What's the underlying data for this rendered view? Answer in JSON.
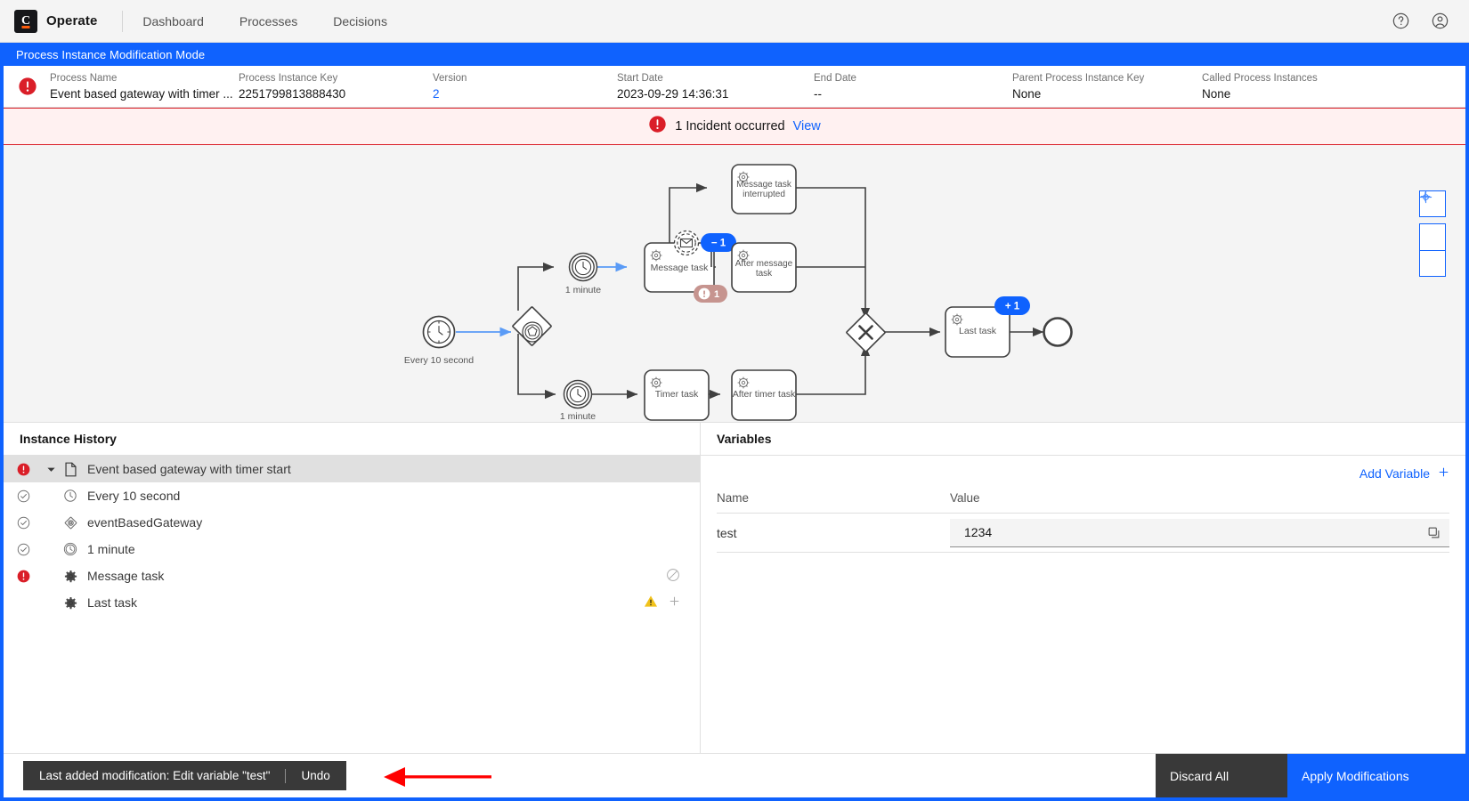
{
  "app": {
    "brand_letter": "C",
    "brand_name": "Operate",
    "nav": [
      {
        "label": "Dashboard",
        "name": "nav-dashboard"
      },
      {
        "label": "Processes",
        "name": "nav-processes"
      },
      {
        "label": "Decisions",
        "name": "nav-decisions"
      }
    ],
    "help_icon": "help-icon",
    "user_icon": "user-avatar-icon"
  },
  "modification_banner": {
    "label": "Process Instance Modification Mode"
  },
  "instance_header": {
    "state_icon": "incident-error-icon",
    "fields": [
      {
        "label": "Process Name",
        "value": "Event based gateway with timer ...",
        "name": "process-name"
      },
      {
        "label": "Process Instance Key",
        "value": "2251799813888430",
        "name": "process-instance-key"
      },
      {
        "label": "Version",
        "value": "2",
        "name": "version",
        "link": true
      },
      {
        "label": "Start Date",
        "value": "2023-09-29 14:36:31",
        "name": "start-date"
      },
      {
        "label": "End Date",
        "value": "--",
        "name": "end-date"
      },
      {
        "label": "Parent Process Instance Key",
        "value": "None",
        "name": "parent-process-instance-key"
      },
      {
        "label": "Called Process Instances",
        "value": "None",
        "name": "called-process-instances"
      }
    ]
  },
  "incident_bar": {
    "icon": "error-filled-icon",
    "text": "1 Incident occurred",
    "view_label": "View",
    "bg": "#fff1f1",
    "border": "#da1e28"
  },
  "diagram": {
    "nodes": [
      {
        "id": "start",
        "type": "timer-start-event",
        "label": "Every 10 second"
      },
      {
        "id": "gateway",
        "type": "event-based-gateway",
        "label": ""
      },
      {
        "id": "timer1",
        "type": "timer-intermediate-event",
        "label": "1 minute"
      },
      {
        "id": "message-task",
        "type": "service-task",
        "label": "Message task"
      },
      {
        "id": "message-task-interrupted",
        "type": "service-task",
        "label": "Message task interrupted"
      },
      {
        "id": "after-message-task",
        "type": "service-task",
        "label": "After message task"
      },
      {
        "id": "timer2",
        "type": "timer-intermediate-event",
        "label": "1 minute"
      },
      {
        "id": "timer-task",
        "type": "service-task",
        "label": "Timer task"
      },
      {
        "id": "after-timer-task",
        "type": "service-task",
        "label": "After timer task"
      },
      {
        "id": "join-gateway",
        "type": "exclusive-gateway",
        "label": ""
      },
      {
        "id": "last-task",
        "type": "service-task",
        "label": "Last task"
      },
      {
        "id": "end",
        "type": "end-event",
        "label": ""
      }
    ],
    "badges": [
      {
        "target": "message-task",
        "text": "− 1",
        "kind": "modification-remove",
        "color": "#0f62fe"
      },
      {
        "target": "message-task",
        "text": "1",
        "kind": "incident-count",
        "color": "#c6948f"
      },
      {
        "target": "last-task",
        "text": "+ 1",
        "kind": "modification-add",
        "color": "#0f62fe"
      }
    ],
    "zoom_controls": [
      {
        "name": "reset-zoom-button",
        "glyph": "reset"
      },
      {
        "name": "zoom-in-button",
        "glyph": "+"
      },
      {
        "name": "zoom-out-button",
        "glyph": "−"
      }
    ]
  },
  "instance_history": {
    "title": "Instance History",
    "rows": [
      {
        "label": "Event based gateway with timer start",
        "state": "incident",
        "icon": "process-document-icon",
        "indent": 0,
        "selected": true,
        "caret": true
      },
      {
        "label": "Every 10 second",
        "state": "completed",
        "icon": "timer-event-icon",
        "indent": 1
      },
      {
        "label": "eventBasedGateway",
        "state": "completed",
        "icon": "event-based-gateway-icon",
        "indent": 1
      },
      {
        "label": "1 minute",
        "state": "completed",
        "icon": "timer-event-icon",
        "indent": 1
      },
      {
        "label": "Message task",
        "state": "incident",
        "icon": "service-task-icon",
        "indent": 1,
        "action": "cancel"
      },
      {
        "label": "Last task",
        "state": "none",
        "icon": "service-task-icon",
        "indent": 1,
        "action": "warning-add"
      }
    ]
  },
  "variables": {
    "title": "Variables",
    "add_label": "Add Variable",
    "columns": {
      "name": "Name",
      "value": "Value"
    },
    "rows": [
      {
        "name": "test",
        "value": "1234",
        "copy_icon": "copy-icon"
      }
    ]
  },
  "footer": {
    "undo_text": "Last added modification: Edit variable \"test\"",
    "undo_label": "Undo",
    "discard_label": "Discard All",
    "apply_label": "Apply Modifications",
    "annotation": "red-arrow-annotation"
  }
}
